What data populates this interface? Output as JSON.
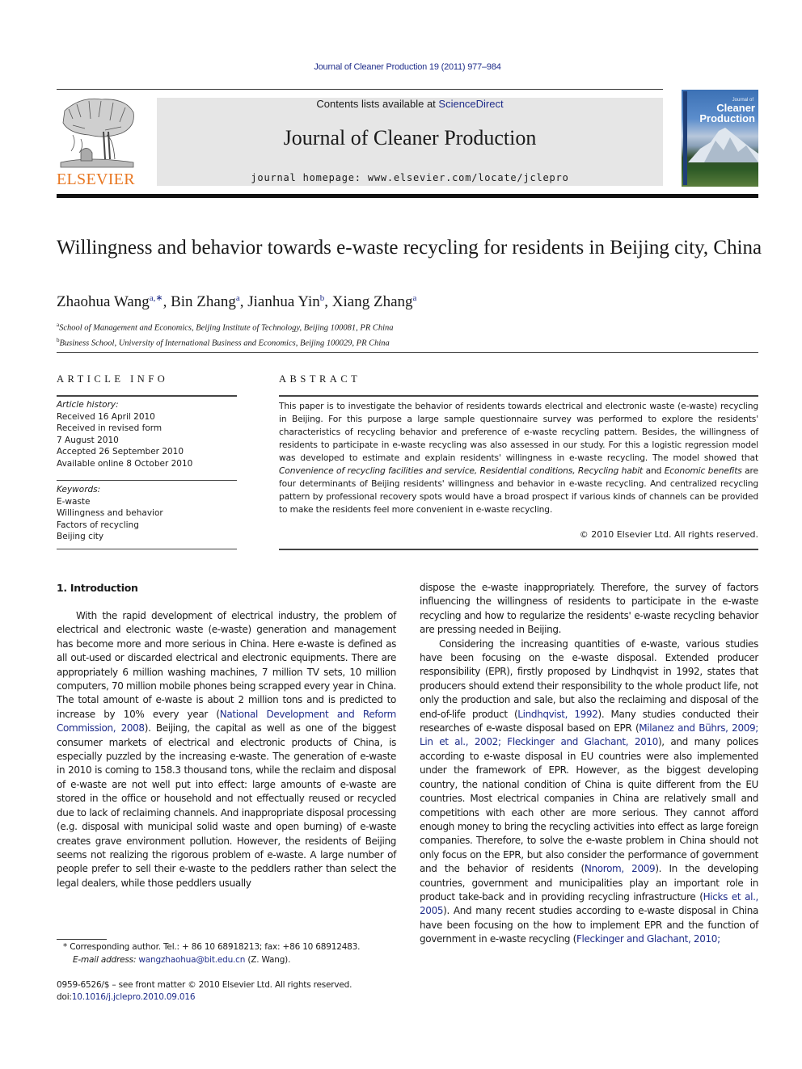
{
  "header": {
    "citation": "Journal of Cleaner Production 19 (2011) 977–984",
    "contents_prefix": "Contents lists available at ",
    "contents_link": "ScienceDirect",
    "journal_name": "Journal of Cleaner Production",
    "homepage": "journal homepage: www.elsevier.com/locate/jclepro",
    "publisher_logo_text": "ELSEVIER",
    "cover": {
      "small_text": "Journal of",
      "title_line1": "Cleaner",
      "title_line2": "Production"
    }
  },
  "article": {
    "title": "Willingness and behavior towards e-waste recycling for residents in Beijing city, China",
    "authors": [
      {
        "name": "Zhaohua Wang",
        "sup": "a,∗"
      },
      {
        "name": "Bin Zhang",
        "sup": "a"
      },
      {
        "name": "Jianhua Yin",
        "sup": "b"
      },
      {
        "name": "Xiang Zhang",
        "sup": "a"
      }
    ],
    "affiliations": [
      {
        "mark": "a",
        "text": "School of Management and Economics, Beijing Institute of Technology, Beijing 100081, PR China"
      },
      {
        "mark": "b",
        "text": "Business School, University of International Business and Economics, Beijing 100029, PR China"
      }
    ]
  },
  "article_info": {
    "heading": "ARTICLE INFO",
    "history_label": "Article history:",
    "history": [
      "Received 16 April 2010",
      "Received in revised form",
      "7 August 2010",
      "Accepted 26 September 2010",
      "Available online 8 October 2010"
    ],
    "keywords_label": "Keywords:",
    "keywords": [
      "E-waste",
      "Willingness and behavior",
      "Factors of recycling",
      "Beijing city"
    ]
  },
  "abstract": {
    "heading": "ABSTRACT",
    "part1": "This paper is to investigate the behavior of residents towards electrical and electronic waste (e-waste) recycling in Beijing. For this purpose a large sample questionnaire survey was performed to explore the residents' characteristics of recycling behavior and preference of e-waste recycling pattern. Besides, the willingness of residents to participate in e-waste recycling was also assessed in our study. For this a logistic regression model was developed to estimate and explain residents' willingness in e-waste recycling. The model showed that ",
    "italic1": "Convenience of recycling facilities and service, Residential conditions, Recycling habit",
    "part2": " and ",
    "italic2": "Economic benefits",
    "part3": " are four determinants of Beijing residents' willingness and behavior in e-waste recycling. And centralized recycling pattern by professional recovery spots would have a broad prospect if various kinds of channels can be provided to make the residents feel more convenient in e-waste recycling.",
    "copyright": "© 2010 Elsevier Ltd. All rights reserved."
  },
  "body": {
    "section_heading": "1.  Introduction",
    "left_p1_a": "With the rapid development of electrical industry, the problem of electrical and electronic waste (e-waste) generation and management has become more and more serious in China. Here e-waste is defined as all out-used or discarded electrical and electronic equipments. There are appropriately 6 million washing machines, 7 million TV sets, 10 million computers, 70 million mobile phones being scrapped every year in China. The total amount of e-waste is about 2 million tons and is predicted to increase by 10% every year (",
    "left_ref1": "National Development and Reform Commission, 2008",
    "left_p1_b": "). Beijing, the capital as well as one of the biggest consumer markets of electrical and electronic products of China, is especially puzzled by the increasing e-waste. The generation of e-waste in 2010 is coming to 158.3 thousand tons, while the reclaim and disposal of e-waste are not well put into effect: large amounts of e-waste are stored in the office or household and not effectually reused or recycled due to lack of reclaiming channels. And inappropriate disposal processing (e.g. disposal with municipal solid waste and open burning) of e-waste creates grave environment pollution. However, the residents of Beijing seems not realizing the rigorous problem of e-waste. A large number of people prefer to sell their e-waste to the peddlers rather than select the legal dealers, while those peddlers usually",
    "right_p1": "dispose the e-waste inappropriately. Therefore, the survey of factors influencing the willingness of residents to participate in the e-waste recycling and how to regularize the residents' e-waste recycling behavior are pressing needed in Beijing.",
    "right_p2_a": "Considering the increasing quantities of e-waste, various studies have been focusing on the e-waste disposal. Extended producer responsibility (EPR), firstly proposed by Lindhqvist in 1992, states that producers should extend their responsibility to the whole product life, not only the production and sale, but also the reclaiming and disposal of the end-of-life product (",
    "right_ref1": "Lindhqvist, 1992",
    "right_p2_b": "). Many studies conducted their researches of e-waste disposal based on EPR (",
    "right_ref2": "Milanez and Bührs, 2009; Lin et al., 2002; Fleckinger and Glachant, 2010",
    "right_p2_c": "), and many polices according to e-waste disposal in EU countries were also implemented under the framework of EPR. However, as the biggest developing country, the national condition of China is quite different from the EU countries. Most electrical companies in China are relatively small and competitions with each other are more serious. They cannot afford enough money to bring the recycling activities into effect as large foreign companies. Therefore, to solve the e-waste problem in China should not only focus on the EPR, but also consider the performance of government and the behavior of residents (",
    "right_ref3": "Nnorom, 2009",
    "right_p2_d": "). In the developing countries, government and municipalities play an important role in product take-back and in providing recycling infrastructure (",
    "right_ref4": "Hicks et al., 2005",
    "right_p2_e": "). And many recent studies according to e-waste disposal in China have been focusing on the how to implement EPR and the function of government in e-waste recycling (",
    "right_ref5": "Fleckinger and Glachant, 2010;"
  },
  "footnote": {
    "mark": "*",
    "corresponding": " Corresponding author. Tel.: + 86 10 68918213; fax: +86 10 68912483.",
    "email_label": "E-mail address:",
    "email": "wangzhaohua@bit.edu.cn",
    "email_suffix": " (Z. Wang).",
    "issn_line": "0959-6526/$ – see front matter © 2010 Elsevier Ltd. All rights reserved.",
    "doi_label": "doi:",
    "doi": "10.1016/j.jclepro.2010.09.016"
  },
  "colors": {
    "link": "#1f2d8a",
    "elsevier_orange": "#e87722",
    "banner_gray": "#e6e6e6"
  }
}
